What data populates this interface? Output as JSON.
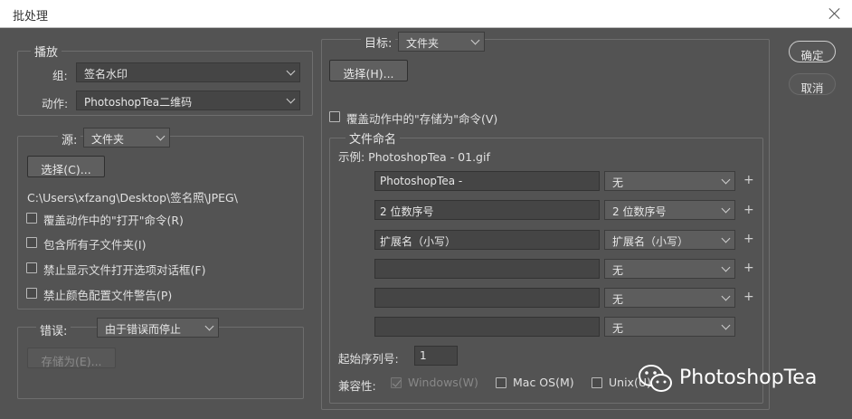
{
  "window": {
    "title": "批处理",
    "close_icon": "close-icon"
  },
  "actions": {
    "ok_label": "确定",
    "cancel_label": "取消"
  },
  "play": {
    "legend": "播放",
    "set_label": "组:",
    "set_value": "签名水印",
    "action_label": "动作:",
    "action_value": "PhotoshopTea二维码"
  },
  "source": {
    "legend_label": "源:",
    "source_value": "文件夹",
    "choose_label": "选择(C)...",
    "path": "C:\\Users\\xfzang\\Desktop\\签名照\\JPEG\\",
    "options": [
      {
        "label": "覆盖动作中的\"打开\"命令(R)",
        "checked": false
      },
      {
        "label": "包含所有子文件夹(I)",
        "checked": false
      },
      {
        "label": "禁止显示文件打开选项对话框(F)",
        "checked": false
      },
      {
        "label": "禁止颜色配置文件警告(P)",
        "checked": false
      }
    ]
  },
  "errors": {
    "legend_label": "错误:",
    "value": "由于错误而停止",
    "save_as_label": "存储为(E)..."
  },
  "destination": {
    "legend_label": "目标:",
    "value": "文件夹",
    "choose_label": "选择(H)...",
    "override_label": "覆盖动作中的\"存储为\"命令(V)"
  },
  "naming": {
    "legend": "文件命名",
    "example": "示例: PhotoshopTea - 01.gif",
    "rows": [
      {
        "text": "PhotoshopTea -",
        "option": "无",
        "plus": "+"
      },
      {
        "text": "2 位数序号",
        "option": "2 位数序号",
        "plus": "+"
      },
      {
        "text": "扩展名（小写）",
        "option": "扩展名（小写）",
        "plus": "+"
      },
      {
        "text": "",
        "option": "无",
        "plus": "+"
      },
      {
        "text": "",
        "option": "无",
        "plus": "+"
      },
      {
        "text": "",
        "option": "无",
        "plus": ""
      }
    ],
    "start_serial_label": "起始序列号:",
    "start_serial_value": "1",
    "compat_label": "兼容性:",
    "compat": [
      {
        "label": "Windows(W)",
        "checked": true,
        "disabled": true
      },
      {
        "label": "Mac OS(M)",
        "checked": false,
        "disabled": false
      },
      {
        "label": "Unix(U)",
        "checked": false,
        "disabled": false
      }
    ]
  },
  "watermark": {
    "icon": "wechat-icon",
    "text": "PhotoshopTea"
  }
}
